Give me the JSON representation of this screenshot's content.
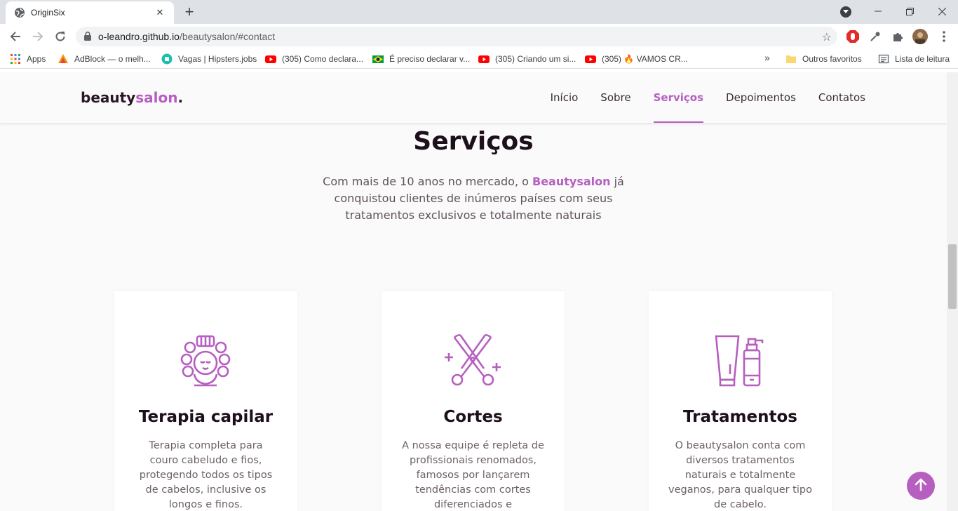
{
  "browser": {
    "tab_title": "OriginSix",
    "tab_close": "✕",
    "new_tab": "+",
    "url_host": "o-leandro.github.io",
    "url_path": "/beautysalon/#contact",
    "window_minimize": "—",
    "window_restore": "❐",
    "window_close": "✕",
    "bookmarks": [
      {
        "label": "Apps",
        "icon": "apps-grid-icon"
      },
      {
        "label": "AdBlock — o melh...",
        "icon": "adblock-icon"
      },
      {
        "label": "Vagas | Hipsters.jobs",
        "icon": "hipsters-icon"
      },
      {
        "label": "(305) Como declara...",
        "icon": "youtube-icon"
      },
      {
        "label": "É preciso declarar v...",
        "icon": "brazil-flag-icon"
      },
      {
        "label": "(305) Criando um si...",
        "icon": "youtube-icon"
      },
      {
        "label": "(305) 🔥 VAMOS CR...",
        "icon": "youtube-icon"
      }
    ],
    "bookmarks_overflow": "»",
    "other_favorites": "Outros favoritos",
    "reading_list": "Lista de leitura"
  },
  "site": {
    "logo_main": "beauty",
    "logo_accent": "salon",
    "logo_dot": ".",
    "nav": [
      {
        "label": "Início",
        "active": false
      },
      {
        "label": "Sobre",
        "active": false
      },
      {
        "label": "Serviços",
        "active": true
      },
      {
        "label": "Depoimentos",
        "active": false
      },
      {
        "label": "Contatos",
        "active": false
      }
    ]
  },
  "services": {
    "title": "Serviços",
    "desc_before": "Com mais de 10 anos no mercado, o ",
    "desc_brand": "Beautysalon",
    "desc_after": " já conquistou clientes de inúmeros países com seus tratamentos exclusivos e totalmente naturais",
    "cards": [
      {
        "title": "Terapia capilar",
        "text": "Terapia completa para couro cabeludo e fios, protegendo todos os tipos de cabelos, inclusive os longos e finos.",
        "icon": "hair-curlers-icon"
      },
      {
        "title": "Cortes",
        "text": "A nossa equipe é repleta de profissionais renomados, famosos por lançarem tendências com cortes diferenciados e",
        "icon": "scissors-icon"
      },
      {
        "title": "Tratamentos",
        "text": "O beautysalon conta com diversos tratamentos naturais e totalmente veganos, para qualquer tipo de cabelo.",
        "icon": "cosmetic-bottles-icon"
      }
    ]
  },
  "colors": {
    "accent": "#b65fc0",
    "heading": "#1e0f1c",
    "body_text": "#6c6169",
    "background": "#fafafa"
  }
}
